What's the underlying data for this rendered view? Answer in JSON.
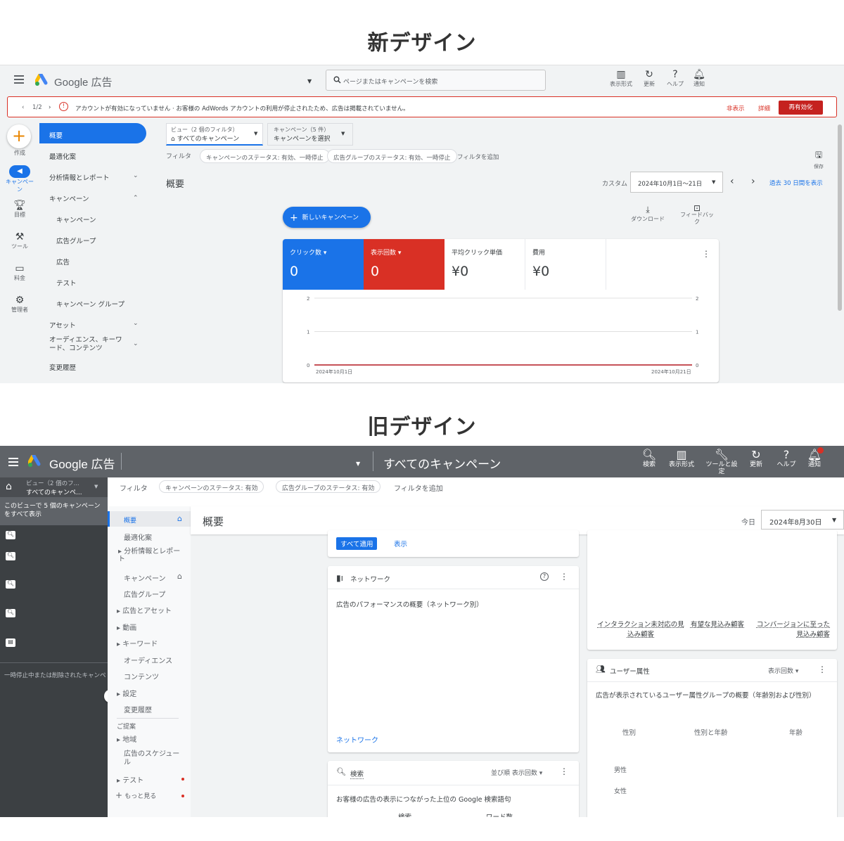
{
  "headings": {
    "new": "新デザイン",
    "old": "旧デザイン"
  },
  "new": {
    "app_title": "Google 広告",
    "search_placeholder": "ページまたはキャンペーンを検索",
    "toolbar": [
      {
        "label": "表示形式",
        "icon": "columns-icon"
      },
      {
        "label": "更新",
        "icon": "refresh-icon"
      },
      {
        "label": "ヘルプ",
        "icon": "help-icon"
      },
      {
        "label": "通知",
        "icon": "bell-icon"
      }
    ],
    "alert": {
      "pager": "1/2",
      "message": "アカウントが有効になっていません · お客様の AdWords アカウントの利用が停止されたため、広告は掲載されていません。",
      "hide": "非表示",
      "details": "詳細",
      "reactivate": "再有効化"
    },
    "rail": [
      "作成",
      "キャンペーン",
      "目標",
      "ツール",
      "料金",
      "管理者"
    ],
    "nav": [
      "概要",
      "最適化案",
      "分析情報とレポート",
      "キャンペーン",
      "キャンペーン",
      "広告グループ",
      "広告",
      "テスト",
      "キャンペーン グループ",
      "アセット",
      "オーディエンス、キーワード、コンテンツ",
      "変更履歴"
    ],
    "view_selector": {
      "label": "ビュー（2 個のフィルタ）",
      "value": "すべてのキャンペーン"
    },
    "campaign_selector": {
      "label": "キャンペーン（5 件）",
      "value": "キャンペーンを選択"
    },
    "filter_label": "フィルタ",
    "filters": [
      "キャンペーンのステータス: 有効、一時停止",
      "広告グループのステータス: 有効、一時停止"
    ],
    "add_filter": "フィルタを追加",
    "save": "保存",
    "page_title": "概要",
    "date_label": "カスタム",
    "date_range": "2024年10月1日～21日",
    "last_30": "過去 30 日間を表示",
    "new_campaign": "新しいキャンペーン",
    "download": "ダウンロード",
    "feedback": "フィードバック",
    "metrics": [
      {
        "label": "クリック数",
        "value": "0",
        "color": "#1a73e8"
      },
      {
        "label": "表示回数",
        "value": "0",
        "color": "#d93025"
      },
      {
        "label": "平均クリック単価",
        "value": "¥0",
        "color": "#ffffff"
      },
      {
        "label": "費用",
        "value": "¥0",
        "color": "#ffffff"
      }
    ]
  },
  "chart_data": {
    "type": "line",
    "x": [
      "2024年10月1日",
      "2024年10月21日"
    ],
    "series": [
      {
        "values": [
          0,
          0
        ]
      },
      {
        "values": [
          0,
          0
        ]
      }
    ],
    "ylim": [
      0,
      2
    ],
    "yticks": [
      "2",
      "1",
      "0"
    ],
    "y2ticks": [
      "2",
      "1",
      "0"
    ],
    "xticks": [
      "2024年10月1日",
      "2024年10月21日"
    ],
    "grid": true
  },
  "old": {
    "app_title": "Google 広告",
    "view_all": "すべてのキャンペーン",
    "toolbar": [
      {
        "label": "検索",
        "icon": "search-icon"
      },
      {
        "label": "表示形式",
        "icon": "columns-icon"
      },
      {
        "label": "ツールと設定",
        "icon": "wrench-icon"
      },
      {
        "label": "更新",
        "icon": "refresh-icon"
      },
      {
        "label": "ヘルプ",
        "icon": "help-icon"
      },
      {
        "label": "通知",
        "icon": "bell-icon"
      }
    ],
    "view_label": "ビュー（2 個のフ...",
    "view_value": "すべてのキャンペ...",
    "view_desc": "このビューで 5 個のキャンペーンをすべて表示",
    "paused_note": "一時停止中または削除されたキャンペ",
    "filter_label": "フィルタ",
    "filters": [
      "キャンペーンのステータス: 有効",
      "広告グループのステータス: 有効"
    ],
    "add_filter": "フィルタを追加",
    "nav": [
      "概要",
      "最適化案",
      "分析情報とレポート",
      "キャンペーン",
      "広告グループ",
      "広告とアセット",
      "動画",
      "キーワード",
      "オーディエンス",
      "コンテンツ",
      "設定",
      "変更履歴",
      "ご提案",
      "地域",
      "広告のスケジュール",
      "テスト",
      "もっと見る"
    ],
    "page_title": "概要",
    "today": "今日",
    "date": "2024年8月30日",
    "apply_all": "すべて適用",
    "show": "表示",
    "network_card": {
      "title": "ネットワーク",
      "desc": "広告のパフォーマンスの概要（ネットワーク別）",
      "link": "ネットワーク"
    },
    "search_card": {
      "title": "検索",
      "sort": "並び順 表示回数",
      "desc": "お客様の広告の表示につながった上位の Google 検索語句",
      "col1": "検索",
      "col2": "ワード数"
    },
    "funnel": {
      "col1": "インタラクション未対応の見込み顧客",
      "col2": "有望な見込み顧客",
      "col3": "コンバージョンに至った見込み顧客"
    },
    "demo_card": {
      "title": "ユーザー属性",
      "metric": "表示回数",
      "desc": "広告が表示されているユーザー属性グループの概要（年齢別および性別）",
      "tabs": [
        "性別",
        "性別と年齢",
        "年齢"
      ],
      "rows": [
        "男性",
        "女性"
      ]
    }
  }
}
